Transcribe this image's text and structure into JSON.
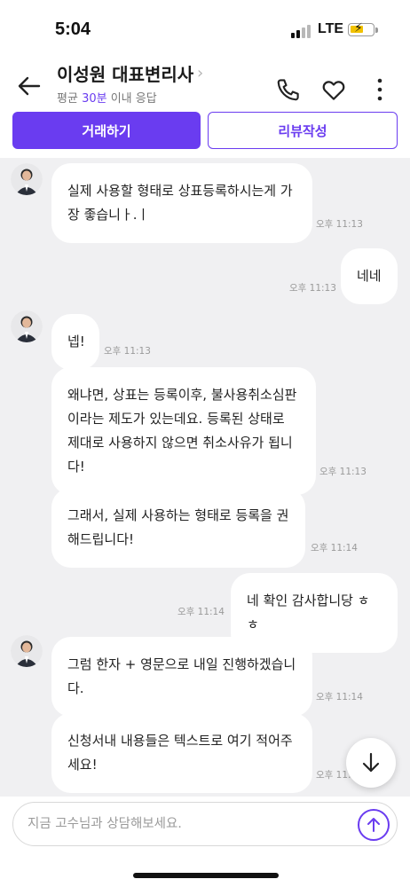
{
  "status_bar": {
    "time": "5:04",
    "network": "LTE"
  },
  "header": {
    "title": "이성원 대표변리사",
    "subtitle_prefix": "평균 ",
    "subtitle_accent": "30분",
    "subtitle_suffix": " 이내 응답"
  },
  "actions": {
    "primary": "거래하기",
    "secondary": "리뷰작성"
  },
  "messages": [
    {
      "side": "left",
      "text": "실제 사용할 형태로 상표등록하시는게 가\n장 좋습니ㅏ.ㅣ",
      "time": "오후 11:13"
    },
    {
      "side": "right",
      "text": "네네",
      "time": "오후 11:13"
    },
    {
      "side": "left",
      "text": "넵!",
      "time": "오후 11:13"
    },
    {
      "side": "left",
      "text": "왜냐면, 상표는 등록이후, 불사용취소심판\n이라는 제도가 있는데요. 등록된 상태로\n제대로 사용하지 않으면 취소사유가 됩니\n다!",
      "time": "오후 11:13"
    },
    {
      "side": "left",
      "text": "그래서, 실제 사용하는 형태로 등록을 권\n해드립니다!",
      "time": "오후 11:14"
    },
    {
      "side": "right",
      "text": "네 확인 감사합니당 ㅎㅎ",
      "time": "오후 11:14"
    },
    {
      "side": "left",
      "text": "그럼 한자 + 영문으로 내일 진행하겠습니\n다.",
      "time": "오후 11:14"
    },
    {
      "side": "left",
      "text": "신청서내 내용들은 텍스트로 여기 적어주\n세요!",
      "time": "오후 11:1"
    }
  ],
  "input": {
    "placeholder": "지금 고수님과 상담해보세요."
  },
  "colors": {
    "accent": "#6a3cf0",
    "chat_bg": "#f0f0f2"
  },
  "icons": [
    "back-arrow-icon",
    "chevron-right-icon",
    "phone-icon",
    "heart-icon",
    "more-vertical-icon",
    "arrow-down-icon",
    "send-arrow-icon"
  ]
}
